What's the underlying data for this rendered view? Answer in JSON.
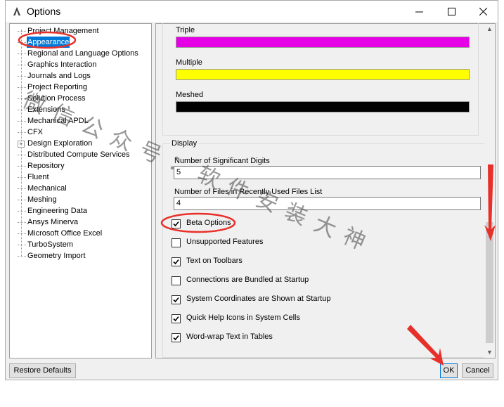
{
  "window": {
    "title": "Options"
  },
  "titlebar": {
    "minimize_glyph": "—",
    "maximize_glyph": "☐",
    "close_glyph": "✕"
  },
  "tree": {
    "items": [
      {
        "label": "Project Management"
      },
      {
        "label": "Appearance",
        "selected": true
      },
      {
        "label": "Regional and Language Options"
      },
      {
        "label": "Graphics Interaction"
      },
      {
        "label": "Journals and Logs"
      },
      {
        "label": "Project Reporting"
      },
      {
        "label": "Solution Process"
      },
      {
        "label": "Extensions"
      },
      {
        "label": "Mechanical APDL"
      },
      {
        "label": "CFX"
      },
      {
        "label": "Design Exploration",
        "expandable": true
      },
      {
        "label": "Distributed Compute Services"
      },
      {
        "label": "Repository"
      },
      {
        "label": "Fluent"
      },
      {
        "label": "Mechanical"
      },
      {
        "label": "Meshing"
      },
      {
        "label": "Engineering Data"
      },
      {
        "label": "Ansys Minerva"
      },
      {
        "label": "Microsoft Office Excel"
      },
      {
        "label": "TurboSystem"
      },
      {
        "label": "Geometry Import"
      }
    ]
  },
  "colors": {
    "triple_label": "Triple",
    "triple_color": "#e600e6",
    "multiple_label": "Multiple",
    "multiple_color": "#ffff00",
    "meshed_label": "Meshed",
    "meshed_color": "#000000"
  },
  "display": {
    "group_title": "Display",
    "sig_digits_label": "Number of Significant Digits",
    "sig_digits_value": "5",
    "recent_files_label": "Number of Files in Recently Used Files List",
    "recent_files_value": "4",
    "options": [
      {
        "label": "Beta Options",
        "checked": true
      },
      {
        "label": "Unsupported Features",
        "checked": false
      },
      {
        "label": "Text on Toolbars",
        "checked": true
      },
      {
        "label": "Connections are Bundled at Startup",
        "checked": false
      },
      {
        "label": "System Coordinates are Shown at Startup",
        "checked": true
      },
      {
        "label": "Quick Help Icons in System Cells",
        "checked": true
      },
      {
        "label": "Word-wrap Text in Tables",
        "checked": true
      }
    ]
  },
  "buttons": {
    "restore": "Restore Defaults",
    "ok": "OK",
    "cancel": "Cancel"
  },
  "watermark": "微信公众号：软件安装大神",
  "annotation_color": "#e8302a"
}
